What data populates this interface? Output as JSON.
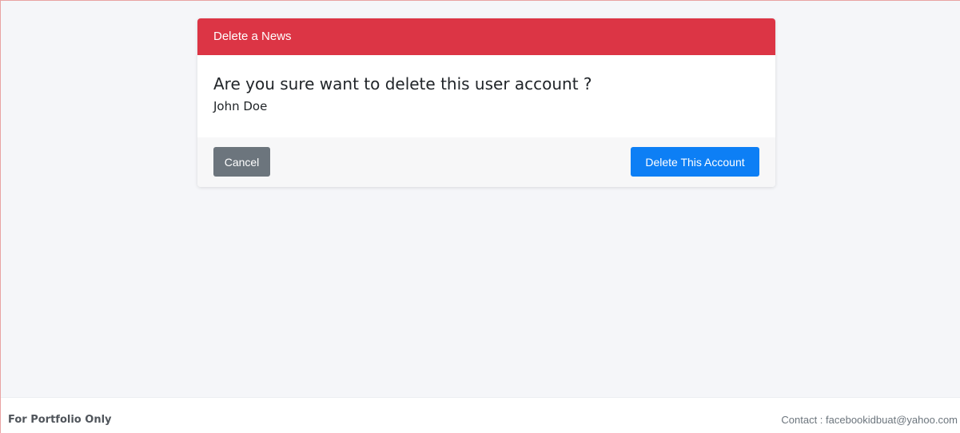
{
  "modal": {
    "header_title": "Delete a News",
    "question": "Are you sure want to delete this user account ?",
    "target_name": "John Doe",
    "cancel_label": "Cancel",
    "delete_label": "Delete This Account"
  },
  "footer": {
    "left_text": "For Portfolio Only",
    "contact_text": "Contact : facebookidbuat@yahoo.com"
  },
  "colors": {
    "header_red": "#dc3545",
    "cancel_gray": "#6c757d",
    "delete_blue": "#0d7ff5",
    "page_background": "#f5f6f9"
  }
}
